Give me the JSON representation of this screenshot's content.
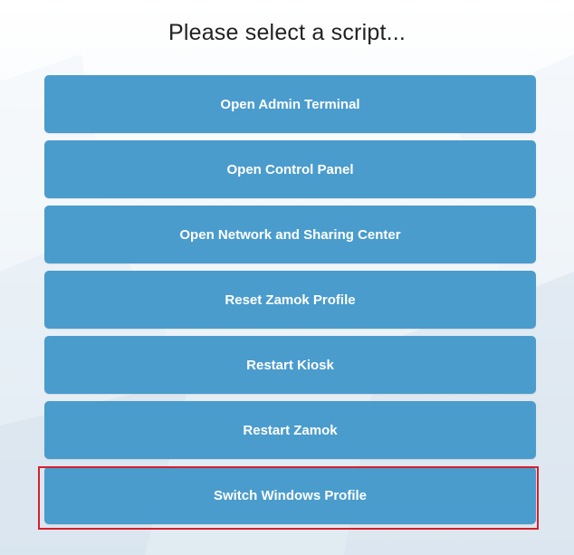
{
  "header": {
    "title": "Please select a script..."
  },
  "scripts": [
    {
      "label": "Open Admin Terminal"
    },
    {
      "label": "Open Control Panel"
    },
    {
      "label": "Open Network and Sharing Center"
    },
    {
      "label": "Reset Zamok Profile"
    },
    {
      "label": "Restart Kiosk"
    },
    {
      "label": "Restart Zamok"
    },
    {
      "label": "Switch Windows Profile"
    }
  ],
  "colors": {
    "button_bg": "#4a9ccd",
    "button_text": "#ffffff",
    "highlight_border": "#d6202a"
  },
  "selection": {
    "highlighted_item": "Switch Windows Profile"
  }
}
